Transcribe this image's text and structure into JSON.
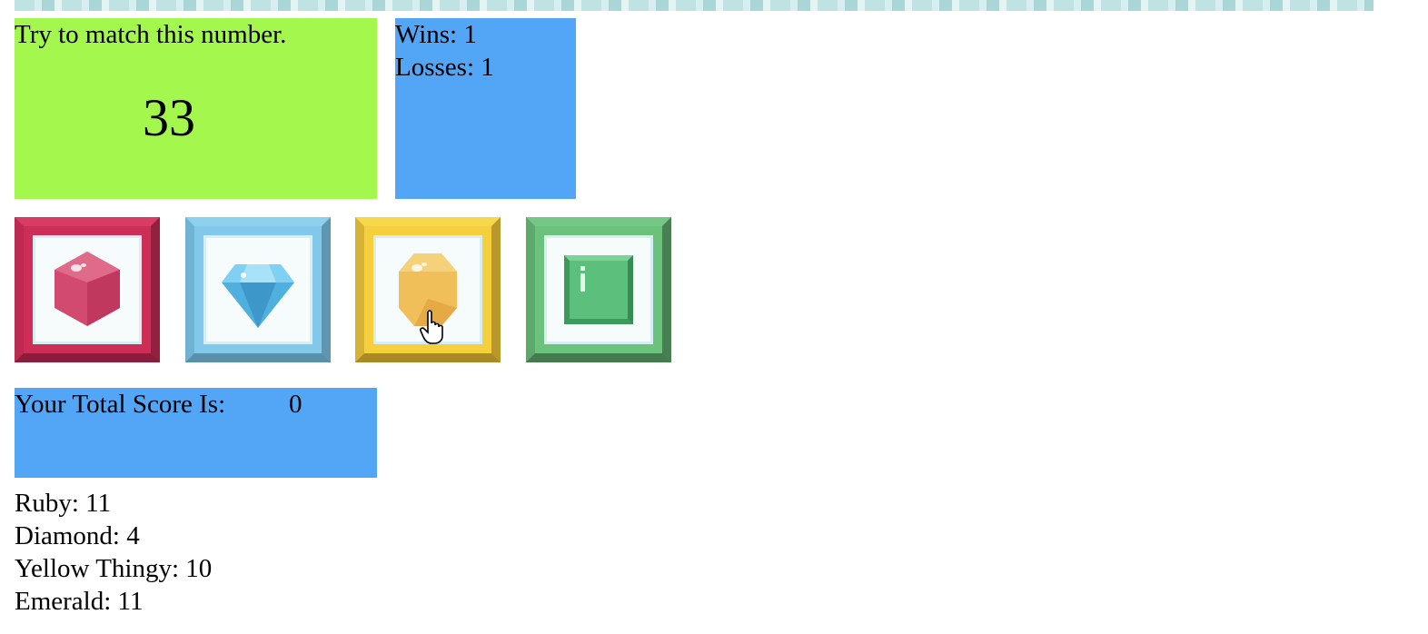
{
  "target": {
    "label": "Try to match this number.",
    "number": "33"
  },
  "stats": {
    "wins_label": "Wins:",
    "wins_value": "1",
    "losses_label": "Losses:",
    "losses_value": "1"
  },
  "gems": [
    {
      "name": "ruby",
      "icon": "ruby-gem-icon",
      "color": "#cc2e57"
    },
    {
      "name": "diamond",
      "icon": "diamond-gem-icon",
      "color": "#82c8ea"
    },
    {
      "name": "yellow",
      "icon": "yellow-gem-icon",
      "color": "#f5cf3c"
    },
    {
      "name": "emerald",
      "icon": "emerald-gem-icon",
      "color": "#6cc17c"
    }
  ],
  "score": {
    "label": "Your Total Score Is:",
    "value": "0"
  },
  "gem_values": [
    {
      "label": "Ruby:",
      "value": "11"
    },
    {
      "label": "Diamond:",
      "value": "4"
    },
    {
      "label": "Yellow Thingy:",
      "value": "10"
    },
    {
      "label": "Emerald:",
      "value": "11"
    }
  ],
  "colors": {
    "target_bg": "#a3f74d",
    "panel_bg": "#52a6f5"
  }
}
